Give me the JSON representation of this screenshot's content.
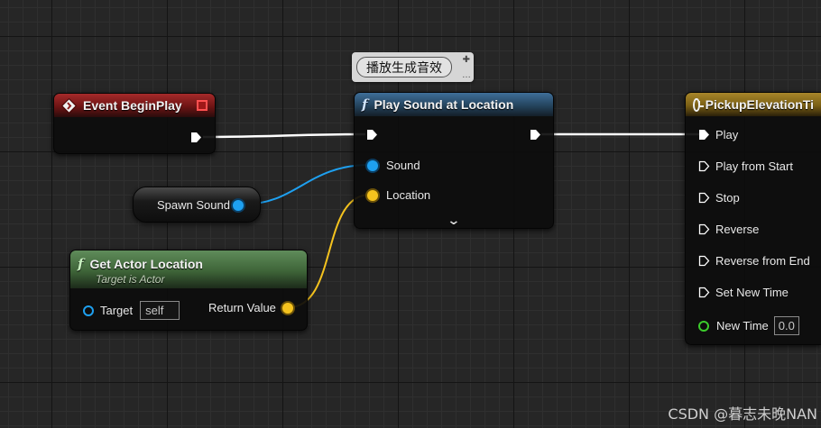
{
  "comment": {
    "text": "播放生成音效",
    "pin_icon": "pin-icon",
    "expand_icon": "dots-icon"
  },
  "event_begin_play": {
    "title": "Event BeginPlay"
  },
  "play_sound": {
    "title": "Play Sound at Location",
    "pins": {
      "sound": "Sound",
      "location": "Location"
    }
  },
  "spawn_sound": {
    "label": "Spawn Sound"
  },
  "get_actor_location": {
    "title": "Get Actor Location",
    "subtitle": "Target is Actor",
    "target_label": "Target",
    "target_value": "self",
    "return_label": "Return Value"
  },
  "timeline": {
    "title": "PickupElevationTi",
    "inputs": [
      "Play",
      "Play from Start",
      "Stop",
      "Reverse",
      "Reverse from End",
      "Set New Time"
    ],
    "new_time_label": "New Time",
    "new_time_value": "0.0"
  },
  "watermark": "CSDN @暮志未晚NAN",
  "colors": {
    "exec_wire": "#ffffff",
    "object_pin": "#1ea0f0",
    "vector_pin": "#f5c31e",
    "float_pin": "#3ccc2c",
    "event_header": "#a52a2a",
    "function_header": "#3f6e98",
    "pure_function_header": "#5f8c5a",
    "timeline_header": "#a8862a"
  }
}
